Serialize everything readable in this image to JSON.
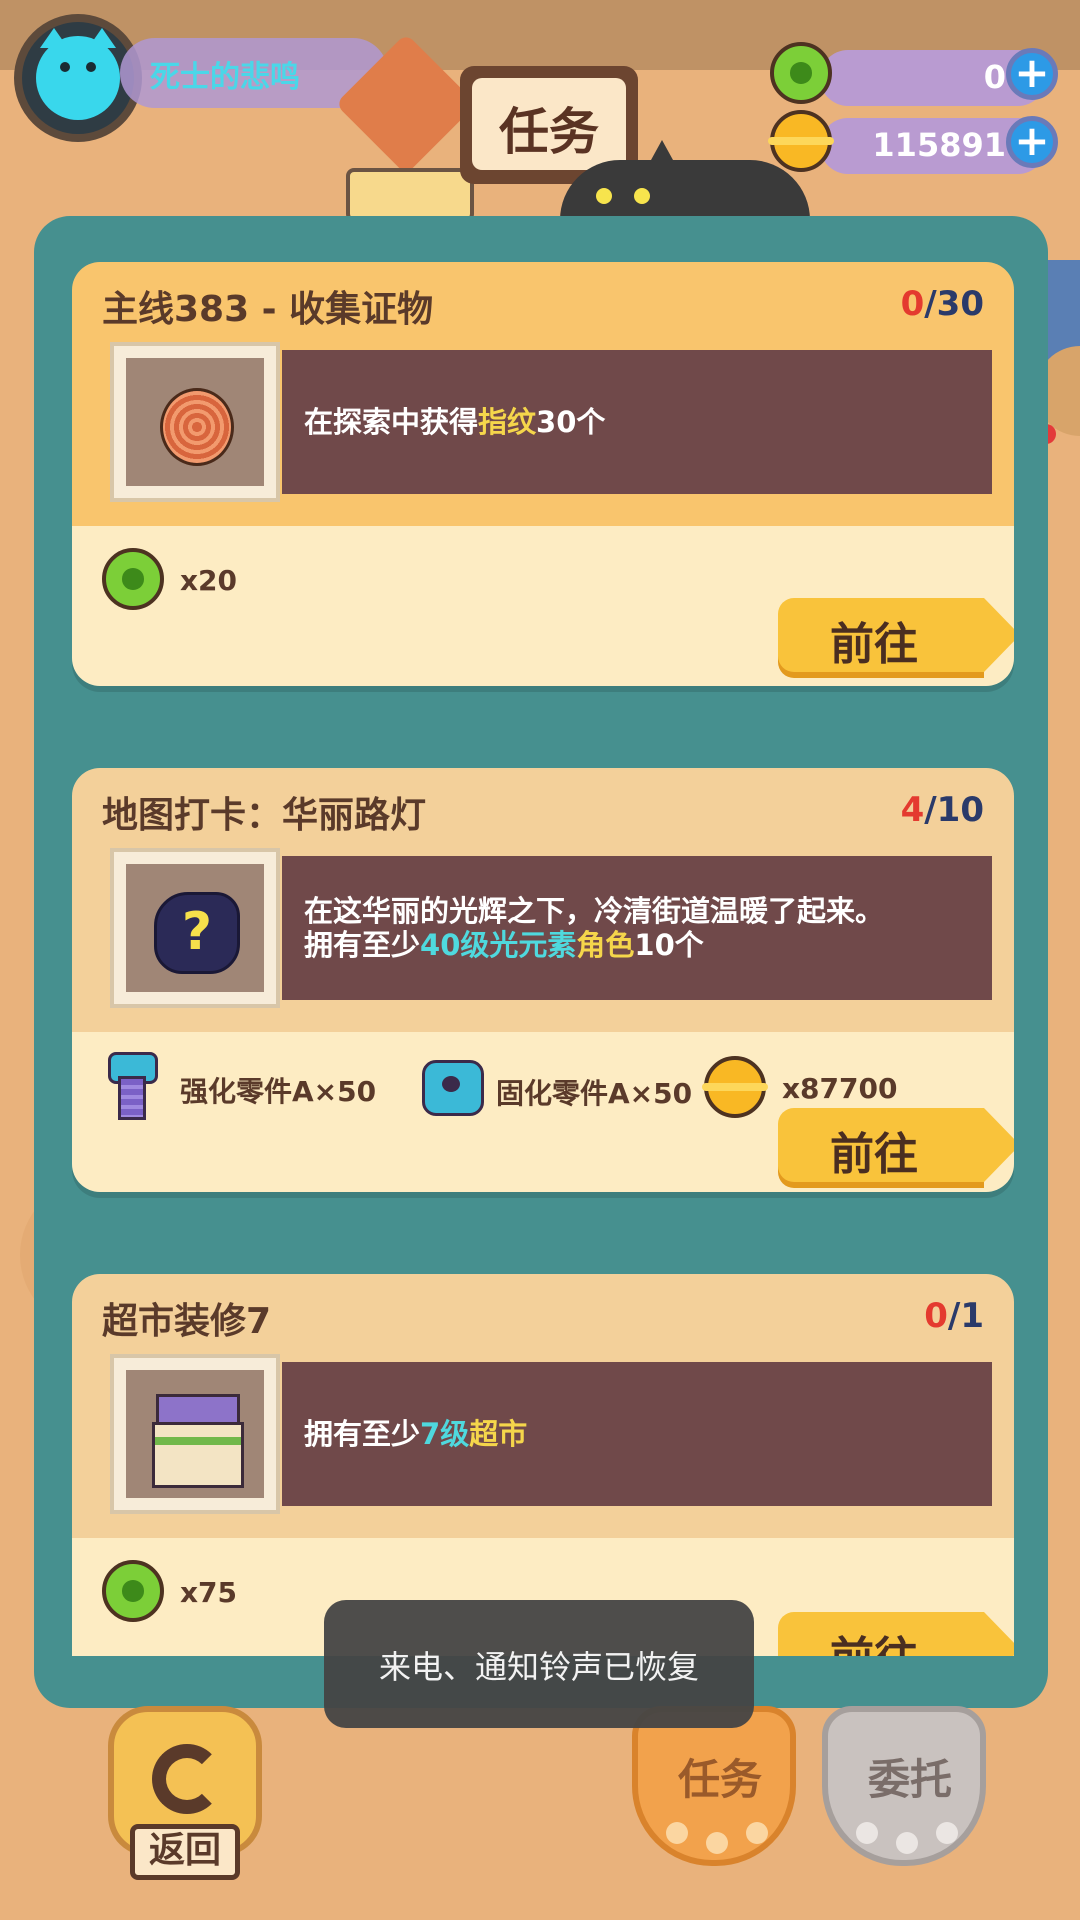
{
  "header": {
    "player_name": "死士的悲鸣",
    "title": "任务"
  },
  "currencies": [
    {
      "icon": "green-token-icon",
      "value": "0"
    },
    {
      "icon": "gold-coin-icon",
      "value": "115891"
    }
  ],
  "tasks": [
    {
      "title": "主线383 - 收集证物",
      "progress_current": "0",
      "progress_total": "/30",
      "image_icon": "fingerprint-icon",
      "desc_parts": [
        "在探索中获得",
        "指纹",
        "30个"
      ],
      "reward_1": "x20",
      "go_label": "前往",
      "header_color": "#f9c56d"
    },
    {
      "title": "地图打卡：华丽路灯",
      "progress_current": "4",
      "progress_total": "/10",
      "image_icon": "mystery-question-icon",
      "desc_line1": "在这华丽的光辉之下，冷清街道温暖了起来。",
      "desc_line2_parts": [
        "拥有至少",
        "40级光元素",
        "角色",
        "10个"
      ],
      "rewards": [
        "强化零件A×50",
        "固化零件A×50",
        "x87700"
      ],
      "go_label": "前往",
      "header_color": "#f3d09a"
    },
    {
      "title": "超市装修7",
      "progress_current": "0",
      "progress_total": "/1",
      "image_icon": "supermarket-icon",
      "desc_parts": [
        "拥有至少",
        "7级",
        "超市"
      ],
      "reward_1": "x75",
      "go_label": "前往",
      "header_color": "#f3d09a"
    }
  ],
  "toast": "来电、通知铃声已恢复",
  "bottom": {
    "back_label": "返回",
    "tab_tasks": "任务",
    "tab_commission": "委托"
  },
  "colors": {
    "panel": "#46908f",
    "desc_bg": "#70494a",
    "highlight_yellow": "#f5d64b",
    "highlight_cyan": "#4fd9de",
    "progress_red": "#e43a2f"
  }
}
